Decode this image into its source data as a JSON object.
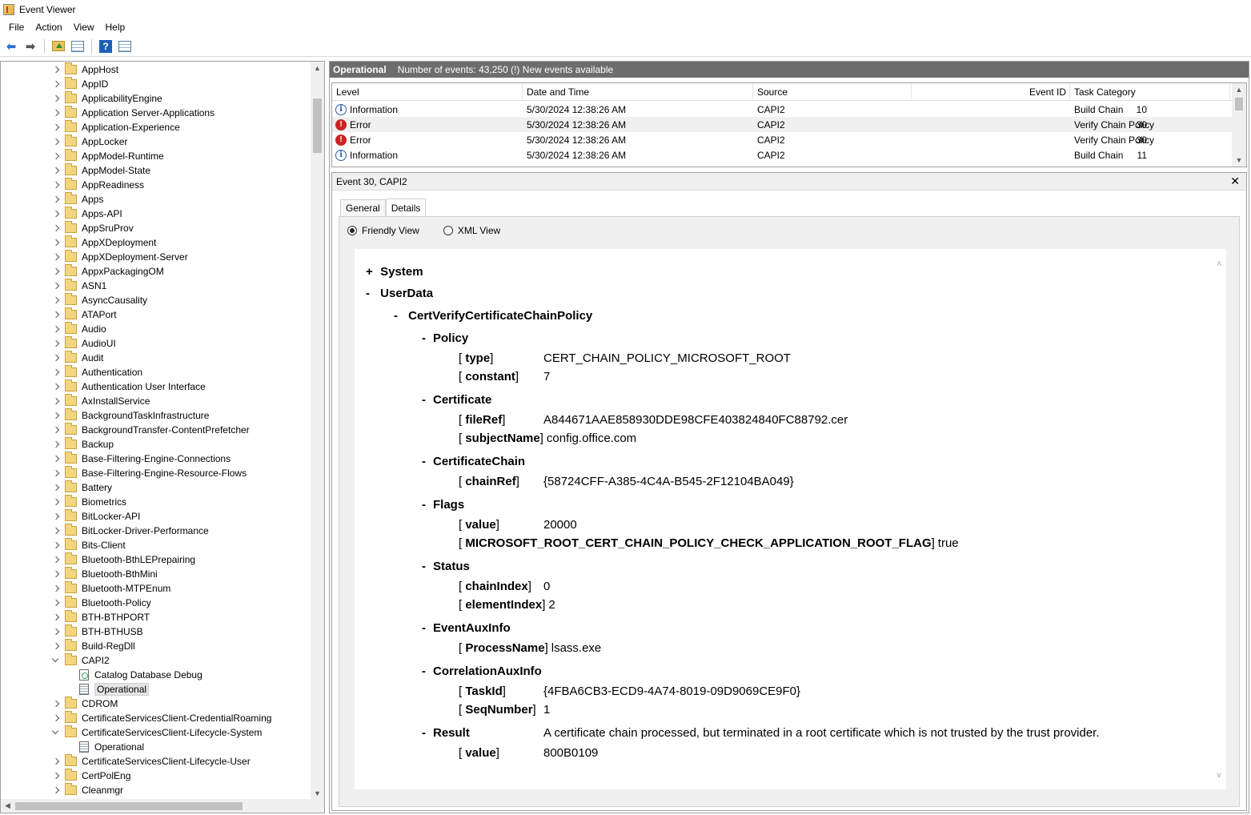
{
  "window": {
    "title": "Event Viewer"
  },
  "menu": [
    "File",
    "Action",
    "View",
    "Help"
  ],
  "toolbar": {
    "back": "back-icon",
    "forward": "forward-icon",
    "up": "folder-up-icon",
    "show_hide": "show-hide-pane-icon",
    "help": "help-icon",
    "properties": "properties-pane-icon"
  },
  "tree": {
    "items": [
      {
        "label": "AppHost",
        "type": "folder",
        "expand": "closed",
        "level": 0
      },
      {
        "label": "AppID",
        "type": "folder",
        "expand": "closed",
        "level": 0
      },
      {
        "label": "ApplicabilityEngine",
        "type": "folder",
        "expand": "closed",
        "level": 0
      },
      {
        "label": "Application Server-Applications",
        "type": "folder",
        "expand": "closed",
        "level": 0
      },
      {
        "label": "Application-Experience",
        "type": "folder",
        "expand": "closed",
        "level": 0
      },
      {
        "label": "AppLocker",
        "type": "folder",
        "expand": "closed",
        "level": 0
      },
      {
        "label": "AppModel-Runtime",
        "type": "folder",
        "expand": "closed",
        "level": 0
      },
      {
        "label": "AppModel-State",
        "type": "folder",
        "expand": "closed",
        "level": 0
      },
      {
        "label": "AppReadiness",
        "type": "folder",
        "expand": "closed",
        "level": 0
      },
      {
        "label": "Apps",
        "type": "folder",
        "expand": "closed",
        "level": 0
      },
      {
        "label": "Apps-API",
        "type": "folder",
        "expand": "closed",
        "level": 0
      },
      {
        "label": "AppSruProv",
        "type": "folder",
        "expand": "closed",
        "level": 0
      },
      {
        "label": "AppXDeployment",
        "type": "folder",
        "expand": "closed",
        "level": 0
      },
      {
        "label": "AppXDeployment-Server",
        "type": "folder",
        "expand": "closed",
        "level": 0
      },
      {
        "label": "AppxPackagingOM",
        "type": "folder",
        "expand": "closed",
        "level": 0
      },
      {
        "label": "ASN1",
        "type": "folder",
        "expand": "closed",
        "level": 0
      },
      {
        "label": "AsyncCausality",
        "type": "folder",
        "expand": "closed",
        "level": 0
      },
      {
        "label": "ATAPort",
        "type": "folder",
        "expand": "closed",
        "level": 0
      },
      {
        "label": "Audio",
        "type": "folder",
        "expand": "closed",
        "level": 0
      },
      {
        "label": "AudioUI",
        "type": "folder",
        "expand": "closed",
        "level": 0
      },
      {
        "label": "Audit",
        "type": "folder",
        "expand": "closed",
        "level": 0
      },
      {
        "label": "Authentication",
        "type": "folder",
        "expand": "closed",
        "level": 0
      },
      {
        "label": "Authentication User Interface",
        "type": "folder",
        "expand": "closed",
        "level": 0
      },
      {
        "label": "AxInstallService",
        "type": "folder",
        "expand": "closed",
        "level": 0
      },
      {
        "label": "BackgroundTaskInfrastructure",
        "type": "folder",
        "expand": "closed",
        "level": 0
      },
      {
        "label": "BackgroundTransfer-ContentPrefetcher",
        "type": "folder",
        "expand": "closed",
        "level": 0
      },
      {
        "label": "Backup",
        "type": "folder",
        "expand": "closed",
        "level": 0
      },
      {
        "label": "Base-Filtering-Engine-Connections",
        "type": "folder",
        "expand": "closed",
        "level": 0
      },
      {
        "label": "Base-Filtering-Engine-Resource-Flows",
        "type": "folder",
        "expand": "closed",
        "level": 0
      },
      {
        "label": "Battery",
        "type": "folder",
        "expand": "closed",
        "level": 0
      },
      {
        "label": "Biometrics",
        "type": "folder",
        "expand": "closed",
        "level": 0
      },
      {
        "label": "BitLocker-API",
        "type": "folder",
        "expand": "closed",
        "level": 0
      },
      {
        "label": "BitLocker-Driver-Performance",
        "type": "folder",
        "expand": "closed",
        "level": 0
      },
      {
        "label": "Bits-Client",
        "type": "folder",
        "expand": "closed",
        "level": 0
      },
      {
        "label": "Bluetooth-BthLEPrepairing",
        "type": "folder",
        "expand": "closed",
        "level": 0
      },
      {
        "label": "Bluetooth-BthMini",
        "type": "folder",
        "expand": "closed",
        "level": 0
      },
      {
        "label": "Bluetooth-MTPEnum",
        "type": "folder",
        "expand": "closed",
        "level": 0
      },
      {
        "label": "Bluetooth-Policy",
        "type": "folder",
        "expand": "closed",
        "level": 0
      },
      {
        "label": "BTH-BTHPORT",
        "type": "folder",
        "expand": "closed",
        "level": 0
      },
      {
        "label": "BTH-BTHUSB",
        "type": "folder",
        "expand": "closed",
        "level": 0
      },
      {
        "label": "Build-RegDll",
        "type": "folder",
        "expand": "closed",
        "level": 0
      },
      {
        "label": "CAPI2",
        "type": "folder",
        "expand": "open",
        "level": 0
      },
      {
        "label": "Catalog Database Debug",
        "type": "debuglog",
        "expand": "none",
        "level": 1
      },
      {
        "label": "Operational",
        "type": "log",
        "expand": "none",
        "level": 1,
        "selected": true
      },
      {
        "label": "CDROM",
        "type": "folder",
        "expand": "closed",
        "level": 0
      },
      {
        "label": "CertificateServicesClient-CredentialRoaming",
        "type": "folder",
        "expand": "closed",
        "level": 0
      },
      {
        "label": "CertificateServicesClient-Lifecycle-System",
        "type": "folder",
        "expand": "open",
        "level": 0
      },
      {
        "label": "Operational",
        "type": "log",
        "expand": "none",
        "level": 1
      },
      {
        "label": "CertificateServicesClient-Lifecycle-User",
        "type": "folder",
        "expand": "closed",
        "level": 0
      },
      {
        "label": "CertPolEng",
        "type": "folder",
        "expand": "closed",
        "level": 0
      },
      {
        "label": "Cleanmgr",
        "type": "folder",
        "expand": "closed",
        "level": 0
      }
    ]
  },
  "ops": {
    "title": "Operational",
    "info": "Number of events: 43,250 (!) New events available"
  },
  "grid": {
    "columns": [
      "Level",
      "Date and Time",
      "Source",
      "Event ID",
      "Task Category"
    ],
    "rows": [
      {
        "level": "Information",
        "icon": "info-icon",
        "datetime": "5/30/2024 12:38:26 AM",
        "source": "CAPI2",
        "event_id": "10",
        "task": "Build Chain",
        "selected": false
      },
      {
        "level": "Error",
        "icon": "error-icon",
        "datetime": "5/30/2024 12:38:26 AM",
        "source": "CAPI2",
        "event_id": "30",
        "task": "Verify Chain Policy",
        "selected": true
      },
      {
        "level": "Error",
        "icon": "error-icon",
        "datetime": "5/30/2024 12:38:26 AM",
        "source": "CAPI2",
        "event_id": "30",
        "task": "Verify Chain Policy",
        "selected": false
      },
      {
        "level": "Information",
        "icon": "info-icon",
        "datetime": "5/30/2024 12:38:26 AM",
        "source": "CAPI2",
        "event_id": "11",
        "task": "Build Chain",
        "selected": false
      }
    ]
  },
  "detail": {
    "title": "Event 30, CAPI2",
    "close": "✕",
    "tabs": [
      "General",
      "Details"
    ],
    "active_tab": "Details",
    "views": [
      "Friendly View",
      "XML View"
    ],
    "selected_view": "Friendly View",
    "xml": {
      "system": "System",
      "userdata": "UserData",
      "root": "CertVerifyCertificateChainPolicy",
      "sections": [
        {
          "name": "Policy",
          "fields": [
            {
              "key": "type",
              "value": "CERT_CHAIN_POLICY_MICROSOFT_ROOT"
            },
            {
              "key": "constant",
              "value": "7"
            }
          ]
        },
        {
          "name": "Certificate",
          "fields": [
            {
              "key": "fileRef",
              "value": "A844671AAE858930DDE98CFE403824840FC88792.cer"
            },
            {
              "key": "subjectName",
              "value": "config.office.com"
            }
          ]
        },
        {
          "name": "CertificateChain",
          "fields": [
            {
              "key": "chainRef",
              "value": "{58724CFF-A385-4C4A-B545-2F12104BA049}"
            }
          ]
        },
        {
          "name": "Flags",
          "fields": [
            {
              "key": "value",
              "value": "20000"
            },
            {
              "key": "MICROSOFT_ROOT_CERT_CHAIN_POLICY_CHECK_APPLICATION_ROOT_FLAG",
              "value": "true"
            }
          ]
        },
        {
          "name": "Status",
          "fields": [
            {
              "key": "chainIndex",
              "value": "0"
            },
            {
              "key": "elementIndex",
              "value": "2"
            }
          ]
        },
        {
          "name": "EventAuxInfo",
          "fields": [
            {
              "key": "ProcessName",
              "value": "lsass.exe"
            }
          ]
        },
        {
          "name": "CorrelationAuxInfo",
          "fields": [
            {
              "key": "TaskId",
              "value": "{4FBA6CB3-ECD9-4A74-8019-09D9069CE9F0}"
            },
            {
              "key": "SeqNumber",
              "value": "1"
            }
          ]
        },
        {
          "name": "Result",
          "text": "A certificate chain processed, but terminated in a root certificate which is not trusted by the trust provider.",
          "fields": [
            {
              "key": "value",
              "value": "800B0109"
            }
          ]
        }
      ]
    }
  }
}
